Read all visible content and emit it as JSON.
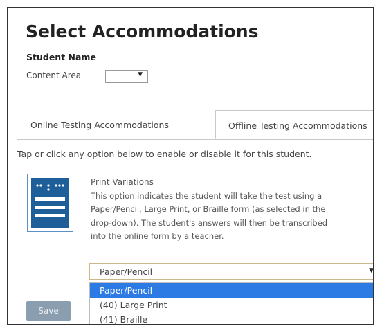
{
  "page": {
    "title": "Select Accommodations",
    "student_name_label": "Student Name",
    "content_area_label": "Content Area"
  },
  "content_area_select": {
    "value": "",
    "arrow_icon": "dropdown-arrow-icon"
  },
  "tabs": [
    {
      "label": "Online Testing Accommodations",
      "active": false
    },
    {
      "label": "Offline Testing Accommodations",
      "active": true
    }
  ],
  "instructions": "Tap or click any option below to enable or disable it for this student.",
  "accommodation": {
    "icon": "print-variations-icon",
    "icon_color": "#1f5f99",
    "title": "Print Variations",
    "description_lines": [
      "This option indicates the student will take the test using a",
      "Paper/Pencil, Large Print, or Braille form (as selected in the",
      "drop-down). The student's answers will then be transcribed",
      "into the online form by a teacher."
    ],
    "selected_value": "Paper/Pencil",
    "options": [
      {
        "label": "Paper/Pencil",
        "highlighted": true
      },
      {
        "label": "(40) Large Print",
        "highlighted": false
      },
      {
        "label": "(41) Braille",
        "highlighted": false
      }
    ]
  },
  "save_label": "Save",
  "colors": {
    "accent": "#2c7be5",
    "icon_blue": "#1f5f99",
    "save_button": "#8a9eb0"
  }
}
